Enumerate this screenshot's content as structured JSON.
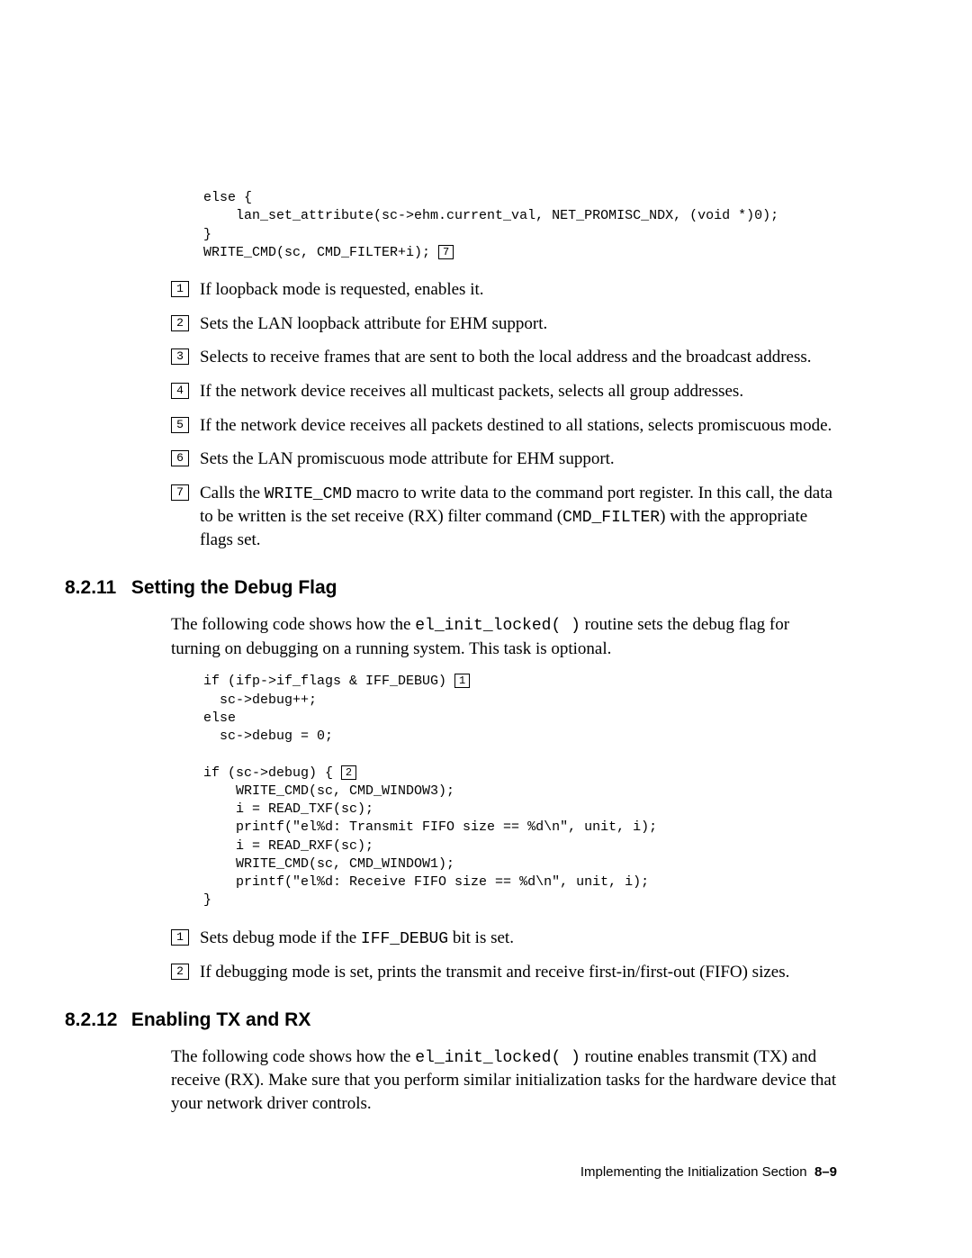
{
  "code1": {
    "l1": "    else {",
    "l2": "        lan_set_attribute(sc->ehm.current_val, NET_PROMISC_NDX, (void *)0);",
    "l3": "    }",
    "l4a": "    WRITE_CMD(sc, CMD_FILTER+i); ",
    "l4cal": "7"
  },
  "list1": {
    "i1": {
      "n": "1",
      "t": "If loopback mode is requested, enables it."
    },
    "i2": {
      "n": "2",
      "t": "Sets the LAN loopback attribute for EHM support."
    },
    "i3": {
      "n": "3",
      "t": "Selects to receive frames that are sent to both the local address and the broadcast address."
    },
    "i4": {
      "n": "4",
      "t": "If the network device receives all multicast packets, selects all group addresses."
    },
    "i5": {
      "n": "5",
      "t": "If the network device receives all packets destined to all stations, selects promiscuous mode."
    },
    "i6": {
      "n": "6",
      "t": "Sets the LAN promiscuous mode attribute for EHM support."
    },
    "i7": {
      "n": "7",
      "pre": "Calls the ",
      "code1": "WRITE_CMD",
      "mid1": " macro to write data to the command port register. In this call, the data to be written is the set receive (RX) filter command (",
      "code2": "CMD_FILTER",
      "post": ") with the appropriate flags set."
    }
  },
  "sect11": {
    "num": "8.2.11",
    "title": "Setting the Debug Flag",
    "para_pre": "The following code shows how the ",
    "para_code": "el_init_locked( )",
    "para_post": " routine sets the debug flag for turning on debugging on a running system. This task is optional."
  },
  "code2": {
    "l1a": "    if (ifp->if_flags & IFF_DEBUG) ",
    "l1cal": "1",
    "l2": "      sc->debug++;",
    "l3": "    else",
    "l4": "      sc->debug = 0;",
    "l5": "",
    "l6a": "    if (sc->debug) { ",
    "l6cal": "2",
    "l7": "        WRITE_CMD(sc, CMD_WINDOW3);",
    "l8": "        i = READ_TXF(sc);",
    "l9": "        printf(\"el%d: Transmit FIFO size == %d\\n\", unit, i);",
    "l10": "        i = READ_RXF(sc);",
    "l11": "        WRITE_CMD(sc, CMD_WINDOW1);",
    "l12": "        printf(\"el%d: Receive FIFO size == %d\\n\", unit, i);",
    "l13": "    }"
  },
  "list2": {
    "i1": {
      "n": "1",
      "pre": "Sets debug mode if the ",
      "code": "IFF_DEBUG",
      "post": " bit is set."
    },
    "i2": {
      "n": "2",
      "t": "If debugging mode is set, prints the transmit and receive first-in/first-out (FIFO) sizes."
    }
  },
  "sect12": {
    "num": "8.2.12",
    "title": "Enabling TX and RX",
    "para_pre": "The following code shows how the ",
    "para_code": "el_init_locked( )",
    "para_post": " routine enables transmit (TX) and receive (RX). Make sure that you perform similar initialization tasks for the hardware device that your network driver controls."
  },
  "footer": {
    "text": "Implementing the Initialization Section",
    "page": "8–9"
  }
}
